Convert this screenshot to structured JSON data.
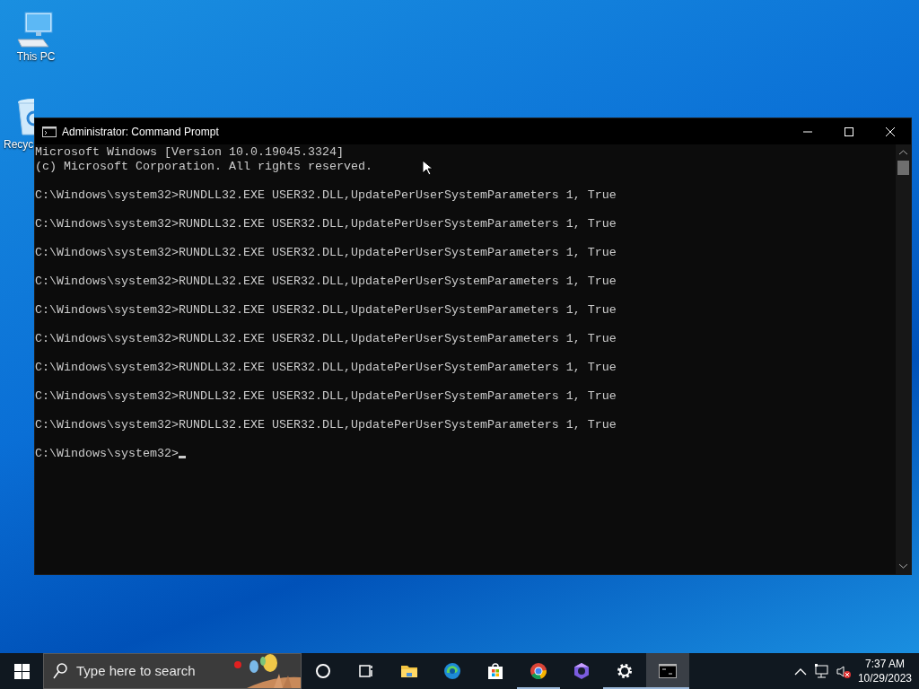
{
  "desktop_icons": [
    {
      "kind": "computer",
      "label": "This PC"
    },
    {
      "kind": "recycle",
      "label": "Recyc"
    }
  ],
  "window": {
    "title": "Administrator: Command Prompt",
    "lines": [
      {
        "kind": "output",
        "text": "Microsoft Windows [Version 10.0.19045.3324]"
      },
      {
        "kind": "output",
        "text": "(c) Microsoft Corporation. All rights reserved."
      },
      {
        "kind": "command",
        "text": "C:\\Windows\\system32>RUNDLL32.EXE USER32.DLL,UpdatePerUserSystemParameters 1, True"
      },
      {
        "kind": "command",
        "text": "C:\\Windows\\system32>RUNDLL32.EXE USER32.DLL,UpdatePerUserSystemParameters 1, True"
      },
      {
        "kind": "command",
        "text": "C:\\Windows\\system32>RUNDLL32.EXE USER32.DLL,UpdatePerUserSystemParameters 1, True"
      },
      {
        "kind": "command",
        "text": "C:\\Windows\\system32>RUNDLL32.EXE USER32.DLL,UpdatePerUserSystemParameters 1, True"
      },
      {
        "kind": "command",
        "text": "C:\\Windows\\system32>RUNDLL32.EXE USER32.DLL,UpdatePerUserSystemParameters 1, True"
      },
      {
        "kind": "command",
        "text": "C:\\Windows\\system32>RUNDLL32.EXE USER32.DLL,UpdatePerUserSystemParameters 1, True"
      },
      {
        "kind": "command",
        "text": "C:\\Windows\\system32>RUNDLL32.EXE USER32.DLL,UpdatePerUserSystemParameters 1, True"
      },
      {
        "kind": "command",
        "text": "C:\\Windows\\system32>RUNDLL32.EXE USER32.DLL,UpdatePerUserSystemParameters 1, True"
      },
      {
        "kind": "command",
        "text": "C:\\Windows\\system32>RUNDLL32.EXE USER32.DLL,UpdatePerUserSystemParameters 1, True"
      },
      {
        "kind": "prompt",
        "text": "C:\\Windows\\system32>",
        "cursor": true
      }
    ]
  },
  "taskbar": {
    "search": {
      "placeholder": "Type here to search"
    },
    "apps": [
      {
        "kind": "taskview-circle",
        "running": false,
        "selected": false
      },
      {
        "kind": "taskview",
        "running": false,
        "selected": false
      },
      {
        "kind": "folder",
        "running": false,
        "selected": false
      },
      {
        "kind": "edge",
        "running": false,
        "selected": false
      },
      {
        "kind": "store",
        "running": false,
        "selected": false
      },
      {
        "kind": "chrome",
        "running": true,
        "selected": false
      },
      {
        "kind": "hexagon",
        "running": false,
        "selected": false
      },
      {
        "kind": "settings",
        "running": true,
        "selected": false
      },
      {
        "kind": "terminal",
        "running": true,
        "selected": true
      }
    ],
    "time": "7:37 AM",
    "date": "10/29/2023"
  }
}
